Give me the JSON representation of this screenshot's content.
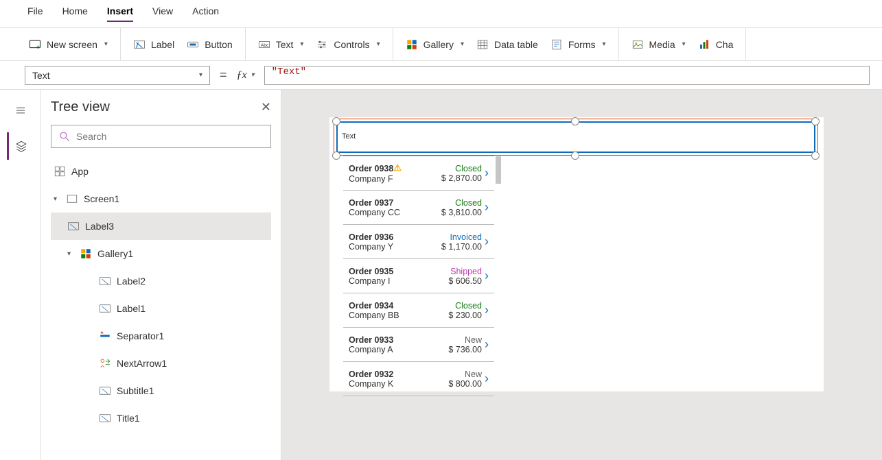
{
  "menubar": [
    "File",
    "Home",
    "Insert",
    "View",
    "Action"
  ],
  "menubar_active": "Insert",
  "ribbon": {
    "new_screen": "New screen",
    "label": "Label",
    "button": "Button",
    "text": "Text",
    "controls": "Controls",
    "gallery": "Gallery",
    "data_table": "Data table",
    "forms": "Forms",
    "media": "Media",
    "charts": "Cha"
  },
  "formula": {
    "property": "Text",
    "value": "\"Text\""
  },
  "tree": {
    "title": "Tree view",
    "search_placeholder": "Search",
    "app": "App",
    "screen": "Screen1",
    "selected": "Label3",
    "gallery": "Gallery1",
    "children": [
      "Label2",
      "Label1",
      "Separator1",
      "NextArrow1",
      "Subtitle1",
      "Title1"
    ]
  },
  "selected_label_text": "Text",
  "gallery_rows": [
    {
      "order": "Order 0938",
      "company": "Company F",
      "status": "Closed",
      "amount": "$ 2,870.00",
      "warn": true
    },
    {
      "order": "Order 0937",
      "company": "Company CC",
      "status": "Closed",
      "amount": "$ 3,810.00"
    },
    {
      "order": "Order 0936",
      "company": "Company Y",
      "status": "Invoiced",
      "amount": "$ 1,170.00"
    },
    {
      "order": "Order 0935",
      "company": "Company I",
      "status": "Shipped",
      "amount": "$ 606.50"
    },
    {
      "order": "Order 0934",
      "company": "Company BB",
      "status": "Closed",
      "amount": "$ 230.00"
    },
    {
      "order": "Order 0933",
      "company": "Company A",
      "status": "New",
      "amount": "$ 736.00"
    },
    {
      "order": "Order 0932",
      "company": "Company K",
      "status": "New",
      "amount": "$ 800.00"
    }
  ]
}
